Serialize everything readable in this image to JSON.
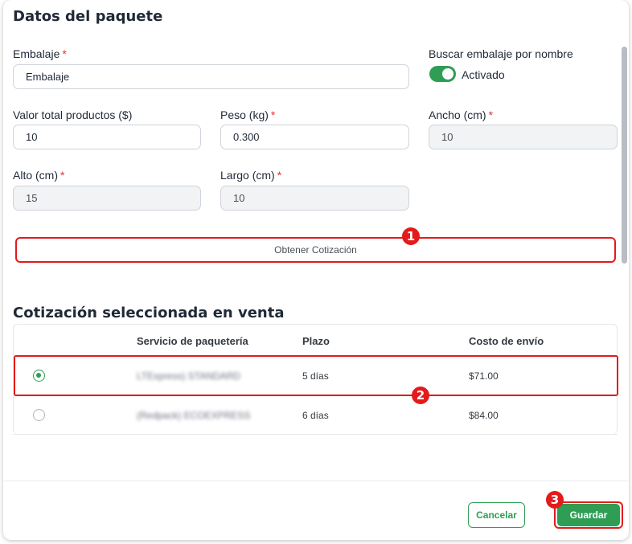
{
  "package": {
    "title": "Datos del paquete",
    "required_mark": "*",
    "packaging": {
      "label": "Embalaje",
      "value": "Embalaje"
    },
    "search_by_name": {
      "label": "Buscar embalaje por nombre",
      "toggle_label": "Activado",
      "enabled": true
    },
    "total_value": {
      "label": "Valor total productos ($)",
      "value": "10"
    },
    "weight": {
      "label": "Peso (kg)",
      "value": "0.300"
    },
    "width": {
      "label": "Ancho (cm)",
      "value": "10"
    },
    "height": {
      "label": "Alto (cm)",
      "value": "15"
    },
    "length": {
      "label": "Largo (cm)",
      "value": "10"
    },
    "quote_button": "Obtener Cotización"
  },
  "quote": {
    "title": "Cotización seleccionada en venta",
    "columns": [
      "Servicio de paquetería",
      "Plazo",
      "Costo de envío"
    ],
    "rows": [
      {
        "service": "LTExpress) STANDARD",
        "term": "5 días",
        "cost": "$71.00",
        "selected": true
      },
      {
        "service": "(Redpack) ECOEXPRESS",
        "term": "6 días",
        "cost": "$84.00",
        "selected": false
      }
    ]
  },
  "footer": {
    "cancel_label": "Cancelar",
    "save_label": "Guardar"
  },
  "annotations": {
    "step1": "1",
    "step2": "2",
    "step3": "3"
  },
  "colors": {
    "accent": "#2f9e54",
    "highlight": "#e31b1b"
  }
}
